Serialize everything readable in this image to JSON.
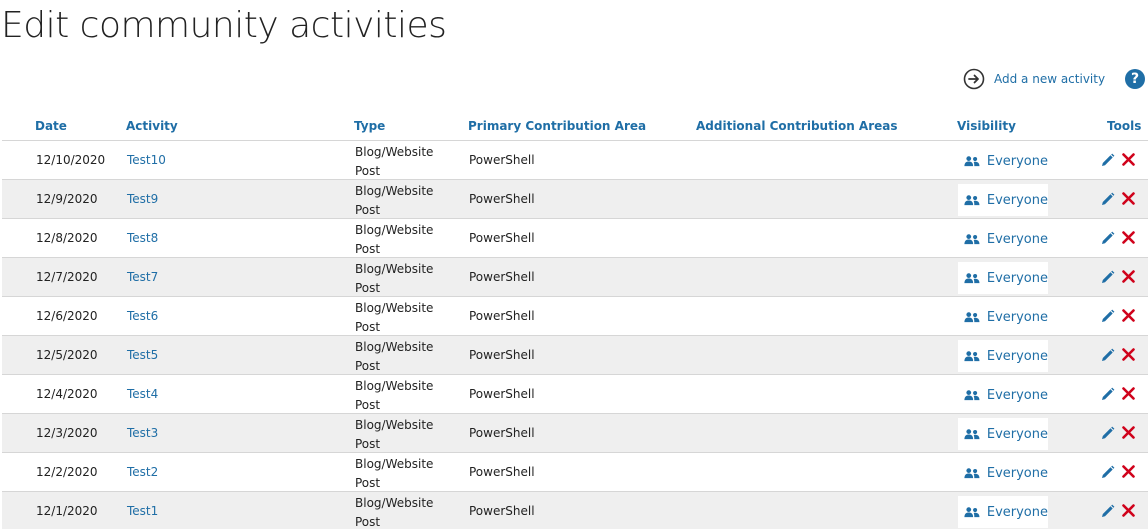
{
  "page": {
    "title": "Edit community activities",
    "add_activity_label": "Add a new activity",
    "help_label": "?"
  },
  "colors": {
    "accent": "#1f6ea6",
    "delete": "#d0021b",
    "row_alt": "#efefef"
  },
  "table": {
    "headers": {
      "date": "Date",
      "activity": "Activity",
      "type": "Type",
      "primary": "Primary Contribution Area",
      "additional": "Additional Contribution Areas",
      "visibility": "Visibility",
      "tools": "Tools"
    },
    "rows": [
      {
        "date": "12/10/2020",
        "activity": "Test10",
        "type": "Blog/Website Post",
        "primary": "PowerShell",
        "additional": "",
        "visibility": "Everyone"
      },
      {
        "date": "12/9/2020",
        "activity": "Test9",
        "type": "Blog/Website Post",
        "primary": "PowerShell",
        "additional": "",
        "visibility": "Everyone"
      },
      {
        "date": "12/8/2020",
        "activity": "Test8",
        "type": "Blog/Website Post",
        "primary": "PowerShell",
        "additional": "",
        "visibility": "Everyone"
      },
      {
        "date": "12/7/2020",
        "activity": "Test7",
        "type": "Blog/Website Post",
        "primary": "PowerShell",
        "additional": "",
        "visibility": "Everyone"
      },
      {
        "date": "12/6/2020",
        "activity": "Test6",
        "type": "Blog/Website Post",
        "primary": "PowerShell",
        "additional": "",
        "visibility": "Everyone"
      },
      {
        "date": "12/5/2020",
        "activity": "Test5",
        "type": "Blog/Website Post",
        "primary": "PowerShell",
        "additional": "",
        "visibility": "Everyone"
      },
      {
        "date": "12/4/2020",
        "activity": "Test4",
        "type": "Blog/Website Post",
        "primary": "PowerShell",
        "additional": "",
        "visibility": "Everyone"
      },
      {
        "date": "12/3/2020",
        "activity": "Test3",
        "type": "Blog/Website Post",
        "primary": "PowerShell",
        "additional": "",
        "visibility": "Everyone"
      },
      {
        "date": "12/2/2020",
        "activity": "Test2",
        "type": "Blog/Website Post",
        "primary": "PowerShell",
        "additional": "",
        "visibility": "Everyone"
      },
      {
        "date": "12/1/2020",
        "activity": "Test1",
        "type": "Blog/Website Post",
        "primary": "PowerShell",
        "additional": "",
        "visibility": "Everyone"
      }
    ]
  },
  "icons": {
    "add": "arrow-right-circle-icon",
    "help": "help-icon",
    "visibility": "people-icon",
    "edit": "pencil-icon",
    "delete": "close-icon"
  }
}
